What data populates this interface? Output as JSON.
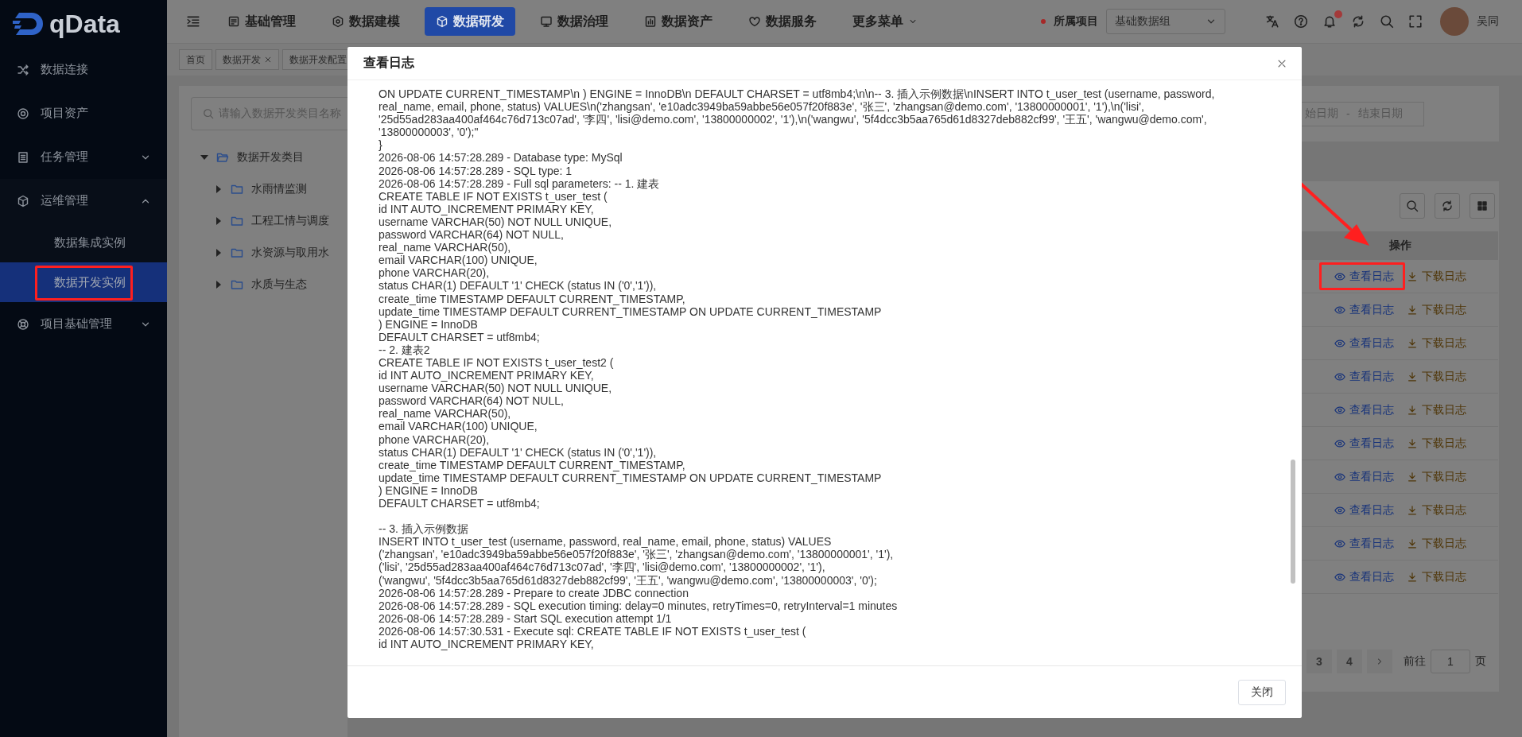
{
  "logo": {
    "text": "qData"
  },
  "sidebar": {
    "items": [
      {
        "label": "数据连接",
        "selected": false
      },
      {
        "label": "项目资产",
        "selected": false
      },
      {
        "label": "任务管理",
        "selected": false,
        "expanded": false
      },
      {
        "label": "运维管理",
        "selected": false,
        "expanded": true,
        "children": [
          {
            "label": "数据集成实例",
            "selected": false,
            "highlighted": false
          },
          {
            "label": "数据开发实例",
            "selected": true,
            "highlighted": true
          }
        ]
      },
      {
        "label": "项目基础管理",
        "selected": false,
        "expanded": false
      }
    ]
  },
  "header": {
    "nav": [
      {
        "label": "基础管理",
        "selected": false,
        "has_menu": false
      },
      {
        "label": "数据建模",
        "selected": false,
        "has_menu": false
      },
      {
        "label": "数据研发",
        "selected": true,
        "has_menu": false
      },
      {
        "label": "数据治理",
        "selected": false,
        "has_menu": false
      },
      {
        "label": "数据资产",
        "selected": false,
        "has_menu": false
      },
      {
        "label": "数据服务",
        "selected": false,
        "has_menu": false
      },
      {
        "label": "更多菜单",
        "selected": false,
        "has_menu": true
      }
    ],
    "project": {
      "label": "所属项目",
      "required": true,
      "value": "基础数据组"
    },
    "notifications": {
      "unread": true
    },
    "user": {
      "name": "吴同"
    }
  },
  "tabs": [
    {
      "label": "首页",
      "selected": false,
      "closable": false
    },
    {
      "label": "数据开发",
      "selected": false,
      "closable": true
    },
    {
      "label": "数据开发配置",
      "selected": false,
      "closable": false
    }
  ],
  "tree": {
    "search": {
      "placeholder": "请输入数据开发类目名称"
    },
    "nodes": [
      {
        "label": "数据开发类目",
        "expanded": true,
        "children": [
          {
            "label": "水雨情监测",
            "expanded": false
          },
          {
            "label": "工程工情与调度",
            "expanded": false
          },
          {
            "label": "水资源与取用水",
            "expanded": false
          },
          {
            "label": "水质与生态",
            "expanded": false
          }
        ]
      }
    ]
  },
  "filter": {
    "date_range": {
      "start_placeholder": "始日期",
      "separator": "-",
      "end_placeholder": "结束日期"
    }
  },
  "table": {
    "columns": [
      "操作"
    ],
    "rows": [
      {
        "highlighted": true,
        "actions": [
          {
            "label": "查看日志",
            "kind": "view"
          },
          {
            "label": "下载日志",
            "kind": "download"
          }
        ]
      },
      {
        "highlighted": false,
        "actions": [
          {
            "label": "查看日志",
            "kind": "view"
          },
          {
            "label": "下载日志",
            "kind": "download"
          }
        ]
      },
      {
        "highlighted": false,
        "actions": [
          {
            "label": "查看日志",
            "kind": "view"
          },
          {
            "label": "下载日志",
            "kind": "download"
          }
        ]
      },
      {
        "highlighted": false,
        "actions": [
          {
            "label": "查看日志",
            "kind": "view"
          },
          {
            "label": "下载日志",
            "kind": "download"
          }
        ]
      },
      {
        "highlighted": false,
        "actions": [
          {
            "label": "查看日志",
            "kind": "view"
          },
          {
            "label": "下载日志",
            "kind": "download"
          }
        ]
      },
      {
        "highlighted": false,
        "actions": [
          {
            "label": "查看日志",
            "kind": "view"
          },
          {
            "label": "下载日志",
            "kind": "download"
          }
        ]
      },
      {
        "highlighted": false,
        "actions": [
          {
            "label": "查看日志",
            "kind": "view"
          },
          {
            "label": "下载日志",
            "kind": "download"
          }
        ]
      },
      {
        "highlighted": false,
        "actions": [
          {
            "label": "查看日志",
            "kind": "view"
          },
          {
            "label": "下载日志",
            "kind": "download"
          }
        ]
      },
      {
        "highlighted": false,
        "actions": [
          {
            "label": "查看日志",
            "kind": "view"
          },
          {
            "label": "下载日志",
            "kind": "download"
          }
        ]
      },
      {
        "highlighted": false,
        "actions": [
          {
            "label": "查看日志",
            "kind": "view"
          },
          {
            "label": "下载日志",
            "kind": "download"
          }
        ]
      }
    ]
  },
  "pagination": {
    "pages": [
      {
        "label": "3",
        "selected": false
      },
      {
        "label": "4",
        "selected": false
      }
    ],
    "goto_label": "前往",
    "goto_value": "1",
    "page_suffix": "页"
  },
  "modal": {
    "title": "查看日志",
    "log_lines": [
      {
        "text": "ON UPDATE CURRENT_TIMESTAMP\\n ) ENGINE = InnoDB\\n DEFAULT CHARSET = utf8mb4;\\n\\n-- 3. 插入示例数据\\nINSERT INTO t_user_test (username, password,"
      },
      {
        "text": "real_name, email, phone, status) VALUES\\n('zhangsan', 'e10adc3949ba59abbe56e057f20f883e', '张三', 'zhangsan@demo.com', '13800000001', '1'),\\n('lisi',"
      },
      {
        "text": "'25d55ad283aa400af464c76d713c07ad', '李四', 'lisi@demo.com', '13800000002', '1'),\\n('wangwu', '5f4dcc3b5aa765d61d8327deb882cf99', '王五', 'wangwu@demo.com',"
      },
      {
        "text": "'13800000003', '0');\""
      },
      {
        "text": "}"
      },
      {
        "text": "2026-08-06 14:57:28.289 - Database type: MySql"
      },
      {
        "text": "2026-08-06 14:57:28.289 - SQL type: 1"
      },
      {
        "text": "2026-08-06 14:57:28.289 - Full sql parameters: -- 1. 建表"
      },
      {
        "text": "CREATE TABLE IF NOT EXISTS t_user_test ("
      },
      {
        "text": "id INT AUTO_INCREMENT PRIMARY KEY,"
      },
      {
        "text": "username VARCHAR(50) NOT NULL UNIQUE,"
      },
      {
        "text": "password VARCHAR(64) NOT NULL,"
      },
      {
        "text": "real_name VARCHAR(50),"
      },
      {
        "text": "email VARCHAR(100) UNIQUE,"
      },
      {
        "text": "phone VARCHAR(20),"
      },
      {
        "text": "status CHAR(1) DEFAULT '1' CHECK (status IN ('0','1')),"
      },
      {
        "text": "create_time TIMESTAMP DEFAULT CURRENT_TIMESTAMP,"
      },
      {
        "text": "update_time TIMESTAMP DEFAULT CURRENT_TIMESTAMP ON UPDATE CURRENT_TIMESTAMP"
      },
      {
        "text": ") ENGINE = InnoDB"
      },
      {
        "text": "DEFAULT CHARSET = utf8mb4;"
      },
      {
        "text": "-- 2. 建表2"
      },
      {
        "text": "CREATE TABLE IF NOT EXISTS t_user_test2 ("
      },
      {
        "text": "id INT AUTO_INCREMENT PRIMARY KEY,"
      },
      {
        "text": "username VARCHAR(50) NOT NULL UNIQUE,"
      },
      {
        "text": "password VARCHAR(64) NOT NULL,"
      },
      {
        "text": "real_name VARCHAR(50),"
      },
      {
        "text": "email VARCHAR(100) UNIQUE,"
      },
      {
        "text": "phone VARCHAR(20),"
      },
      {
        "text": "status CHAR(1) DEFAULT '1' CHECK (status IN ('0','1')),"
      },
      {
        "text": "create_time TIMESTAMP DEFAULT CURRENT_TIMESTAMP,"
      },
      {
        "text": "update_time TIMESTAMP DEFAULT CURRENT_TIMESTAMP ON UPDATE CURRENT_TIMESTAMP"
      },
      {
        "text": ") ENGINE = InnoDB"
      },
      {
        "text": "DEFAULT CHARSET = utf8mb4;"
      },
      {
        "text": "-- 3. 插入示例数据",
        "gap_before": true
      },
      {
        "text": "INSERT INTO t_user_test (username, password, real_name, email, phone, status) VALUES"
      },
      {
        "text": "('zhangsan', 'e10adc3949ba59abbe56e057f20f883e', '张三', 'zhangsan@demo.com', '13800000001', '1'),"
      },
      {
        "text": "('lisi', '25d55ad283aa400af464c76d713c07ad', '李四', 'lisi@demo.com', '13800000002', '1'),"
      },
      {
        "text": "('wangwu', '5f4dcc3b5aa765d61d8327deb882cf99', '王五', 'wangwu@demo.com', '13800000003', '0');"
      },
      {
        "text": "2026-08-06 14:57:28.289 - Prepare to create JDBC connection"
      },
      {
        "text": "2026-08-06 14:57:28.289 - SQL execution timing: delay=0 minutes, retryTimes=0, retryInterval=1 minutes"
      },
      {
        "text": "2026-08-06 14:57:28.289 - Start SQL execution attempt 1/1"
      },
      {
        "text": "2026-08-06 14:57:30.531 - Execute sql: CREATE TABLE IF NOT EXISTS t_user_test ("
      },
      {
        "text": "id INT AUTO_INCREMENT PRIMARY KEY,"
      }
    ],
    "buttons": [
      {
        "label": "关闭"
      }
    ]
  }
}
